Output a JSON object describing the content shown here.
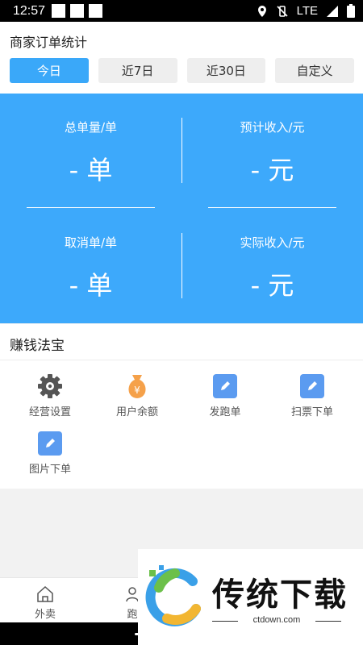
{
  "status_bar": {
    "time": "12:57",
    "network": "LTE"
  },
  "header": {
    "title": "商家订单统计",
    "tabs": [
      {
        "label": "今日",
        "active": true
      },
      {
        "label": "近7日",
        "active": false
      },
      {
        "label": "近30日",
        "active": false
      },
      {
        "label": "自定义",
        "active": false
      }
    ]
  },
  "stats": {
    "total_orders": {
      "label": "总单量/单",
      "value": "- 单"
    },
    "expected_income": {
      "label": "预计收入/元",
      "value": "- 元"
    },
    "cancelled_orders": {
      "label": "取消单/单",
      "value": "- 单"
    },
    "actual_income": {
      "label": "实际收入/元",
      "value": "- 元"
    }
  },
  "tools": {
    "title": "赚钱法宝",
    "items": [
      {
        "label": "经营设置",
        "icon": "gear-icon"
      },
      {
        "label": "用户余额",
        "icon": "money-bag-icon"
      },
      {
        "label": "发跑单",
        "icon": "edit-icon"
      },
      {
        "label": "扫票下单",
        "icon": "edit-icon"
      },
      {
        "label": "图片下单",
        "icon": "edit-icon"
      }
    ]
  },
  "bottom_nav": [
    {
      "label": "外卖",
      "icon": "home-icon"
    },
    {
      "label": "跑",
      "icon": "run-icon"
    }
  ],
  "watermark": {
    "text": "传统下载",
    "url": "ctdown.com"
  },
  "colors": {
    "primary": "#3da9fb",
    "tab_active": "#3aa8f9",
    "edit_icon": "#5b9bf0",
    "money_bag": "#f5a14a",
    "gear": "#555555"
  }
}
